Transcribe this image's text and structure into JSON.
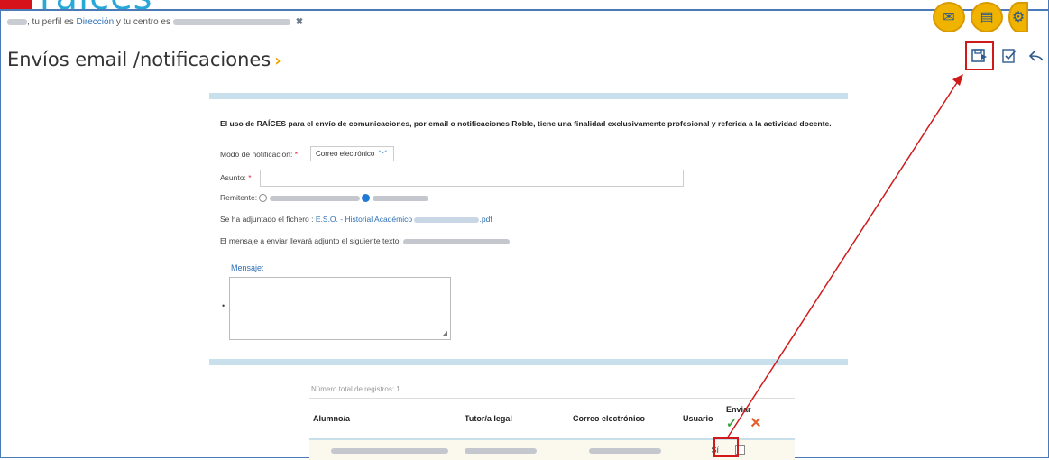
{
  "brand": {
    "logo_text": "raíces"
  },
  "profile": {
    "prefix": ", tu perfil es ",
    "role_link": "Dirección",
    "middle": " y tu centro es ",
    "close_symbol": "✖"
  },
  "header_icons": [
    "mail-icon",
    "printer-icon",
    "settings-icon"
  ],
  "page": {
    "title": "Envíos email /notificaciones",
    "title_chevron": "›"
  },
  "notice": "El uso de RAÍCES para el envío de comunicaciones, por email o notificaciones Roble, tiene una finalidad exclusivamente profesional y referida a la actividad docente.",
  "form": {
    "mode_label": "Modo de notificación:",
    "mode_value": "Correo electrónico",
    "subject_label": "Asunto:",
    "sender_label": "Remitente:",
    "attached_label": "Se ha adjuntado el fichero :",
    "attached_file_prefix": "E.S.O. - Historial Académico",
    "attached_file_ext": ".pdf",
    "footer_text_label": "El mensaje a enviar llevará adjunto el siguiente texto:",
    "message_label": "Mensaje:",
    "bullet": "•"
  },
  "table": {
    "count_label": "Número total de registros: 1",
    "headers": {
      "student": "Alumno/a",
      "tutor": "Tutor/a legal",
      "email": "Correo electrónico",
      "user": "Usuario",
      "send": "Enviar"
    },
    "rows": [
      {
        "user": "Sí"
      }
    ]
  },
  "colors": {
    "accent_blue": "#26a8d8",
    "highlight_red": "#d01a1a",
    "band": "#c7e0ec"
  }
}
